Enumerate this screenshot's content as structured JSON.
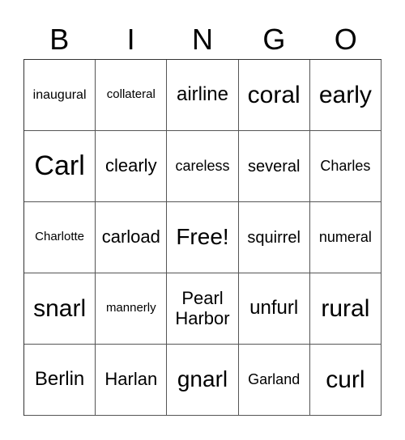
{
  "header": [
    "B",
    "I",
    "N",
    "G",
    "O"
  ],
  "cells": [
    [
      "inaugural",
      "collateral",
      "airline",
      "coral",
      "early"
    ],
    [
      "Carl",
      "clearly",
      "careless",
      "several",
      "Charles"
    ],
    [
      "Charlotte",
      "carload",
      "Free!",
      "squirrel",
      "numeral"
    ],
    [
      "snarl",
      "mannerly",
      "Pearl Harbor",
      "unfurl",
      "rural"
    ],
    [
      "Berlin",
      "Harlan",
      "gnarl",
      "Garland",
      "curl"
    ]
  ]
}
